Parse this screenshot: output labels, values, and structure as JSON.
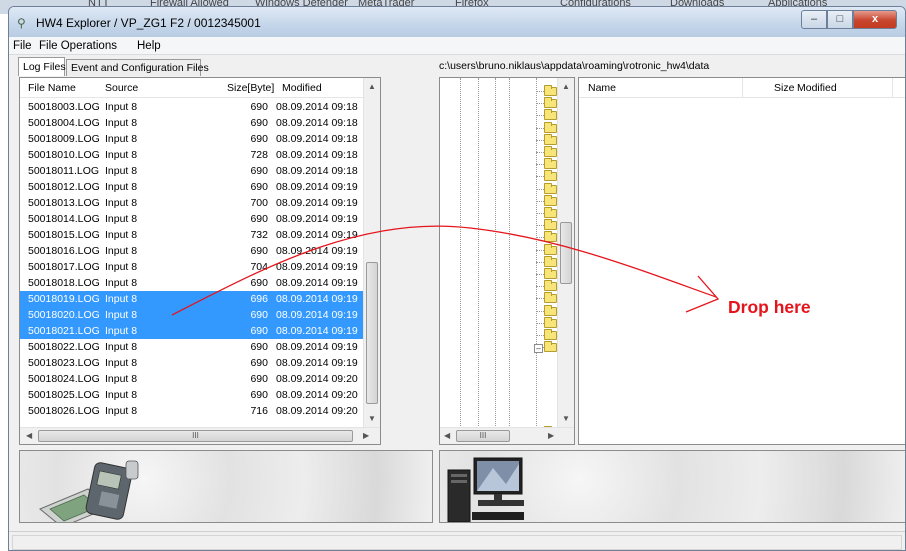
{
  "background_fragments": [
    "NTT",
    "Firewall Allowed",
    "Windows Defender",
    "MetaTrader",
    "Firefox",
    "Configurations",
    "Downloads",
    "Applications"
  ],
  "window": {
    "title": "HW4 Explorer / VP_ZG1 F2 / 0012345001",
    "controls": {
      "minimize": "–",
      "maximize": "□",
      "close": "x"
    }
  },
  "menu": [
    "File",
    "File Operations",
    "Help"
  ],
  "tabs": {
    "log_files": "Log Files",
    "event_config": "Event and Configuration Files"
  },
  "log_table": {
    "headers": {
      "name": "File Name",
      "source": "Source",
      "size": "Size[Byte]",
      "modified": "Modified"
    },
    "rows": [
      {
        "name": "50018003.LOG",
        "source": "Input 8",
        "size": "690",
        "modified": "08.09.2014 09:18",
        "selected": false
      },
      {
        "name": "50018004.LOG",
        "source": "Input 8",
        "size": "690",
        "modified": "08.09.2014 09:18",
        "selected": false
      },
      {
        "name": "50018009.LOG",
        "source": "Input 8",
        "size": "690",
        "modified": "08.09.2014 09:18",
        "selected": false
      },
      {
        "name": "50018010.LOG",
        "source": "Input 8",
        "size": "728",
        "modified": "08.09.2014 09:18",
        "selected": false
      },
      {
        "name": "50018011.LOG",
        "source": "Input 8",
        "size": "690",
        "modified": "08.09.2014 09:18",
        "selected": false
      },
      {
        "name": "50018012.LOG",
        "source": "Input 8",
        "size": "690",
        "modified": "08.09.2014 09:19",
        "selected": false
      },
      {
        "name": "50018013.LOG",
        "source": "Input 8",
        "size": "700",
        "modified": "08.09.2014 09:19",
        "selected": false
      },
      {
        "name": "50018014.LOG",
        "source": "Input 8",
        "size": "690",
        "modified": "08.09.2014 09:19",
        "selected": false
      },
      {
        "name": "50018015.LOG",
        "source": "Input 8",
        "size": "732",
        "modified": "08.09.2014 09:19",
        "selected": false
      },
      {
        "name": "50018016.LOG",
        "source": "Input 8",
        "size": "690",
        "modified": "08.09.2014 09:19",
        "selected": false
      },
      {
        "name": "50018017.LOG",
        "source": "Input 8",
        "size": "704",
        "modified": "08.09.2014 09:19",
        "selected": false
      },
      {
        "name": "50018018.LOG",
        "source": "Input 8",
        "size": "690",
        "modified": "08.09.2014 09:19",
        "selected": false
      },
      {
        "name": "50018019.LOG",
        "source": "Input 8",
        "size": "696",
        "modified": "08.09.2014 09:19",
        "selected": true
      },
      {
        "name": "50018020.LOG",
        "source": "Input 8",
        "size": "690",
        "modified": "08.09.2014 09:19",
        "selected": true
      },
      {
        "name": "50018021.LOG",
        "source": "Input 8",
        "size": "690",
        "modified": "08.09.2014 09:19",
        "selected": true
      },
      {
        "name": "50018022.LOG",
        "source": "Input 8",
        "size": "690",
        "modified": "08.09.2014 09:19",
        "selected": false
      },
      {
        "name": "50018023.LOG",
        "source": "Input 8",
        "size": "690",
        "modified": "08.09.2014 09:19",
        "selected": false
      },
      {
        "name": "50018024.LOG",
        "source": "Input 8",
        "size": "690",
        "modified": "08.09.2014 09:20",
        "selected": false
      },
      {
        "name": "50018025.LOG",
        "source": "Input 8",
        "size": "690",
        "modified": "08.09.2014 09:20",
        "selected": false
      },
      {
        "name": "50018026.LOG",
        "source": "Input 8",
        "size": "716",
        "modified": "08.09.2014 09:20",
        "selected": false
      }
    ]
  },
  "scroll_glyphs": {
    "up": "▲",
    "down": "▼",
    "left": "◀",
    "right": "▶",
    "grip": "III"
  },
  "right_pane": {
    "path": "c:\\users\\bruno.niklaus\\appdata\\roaming\\rotronic_hw4\\data",
    "headers": {
      "name": "Name",
      "size": "Size",
      "modified": "Modified"
    }
  },
  "annotation": {
    "drop_label": "Drop here",
    "color": "#e5141c"
  },
  "colors": {
    "selection": "#3399ff",
    "title_bar": "#c5d6ea"
  }
}
